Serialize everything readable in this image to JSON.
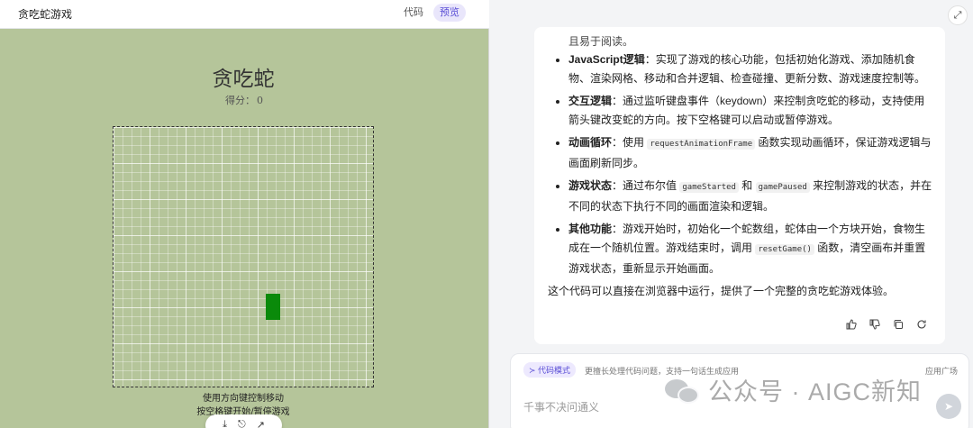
{
  "left": {
    "title": "贪吃蛇游戏",
    "tabs": [
      {
        "label": "代码"
      },
      {
        "label": "预览"
      }
    ],
    "game": {
      "title": "贪吃蛇",
      "score_label": "得分：",
      "score_value": "0",
      "hint_line1": "使用方向键控制移动",
      "hint_line2": "按空格键开始/暂停游戏"
    },
    "floatbar": {
      "icons": [
        "download-icon",
        "share-icon",
        "open-external-icon"
      ],
      "glyphs": [
        "⤓",
        "⎋",
        "↗"
      ]
    }
  },
  "right": {
    "top_cut": "且易于阅读。",
    "items": [
      {
        "label": "JavaScript逻辑",
        "text": "：实现了游戏的核心功能，包括初始化游戏、添加随机食物、渲染网格、移动和合并逻辑、检查碰撞、更新分数、游戏速度控制等。"
      },
      {
        "label": "交互逻辑",
        "text": "：通过监听键盘事件（keydown）来控制贪吃蛇的移动，支持使用箭头键改变蛇的方向。按下空格键可以启动或暂停游戏。"
      },
      {
        "label": "动画循环",
        "pre": "：使用 ",
        "code": "requestAnimationFrame",
        "post": " 函数实现动画循环，保证游戏逻辑与画面刷新同步。"
      },
      {
        "label": "游戏状态",
        "pre": "：通过布尔值 ",
        "code": "gameStarted",
        "mid": " 和 ",
        "code2": "gamePaused",
        "post": " 来控制游戏的状态，并在不同的状态下执行不同的画面渲染和逻辑。"
      },
      {
        "label": "其他功能",
        "pre": "：游戏开始时，初始化一个蛇数组，蛇体由一个方块开始，食物生成在一个随机位置。游戏结束时，调用 ",
        "code": "resetGame()",
        "post": " 函数，清空画布并重置游戏状态，重新显示开始画面。"
      }
    ],
    "summary": "这个代码可以直接在浏览器中运行，提供了一个完整的贪吃蛇游戏体验。",
    "actions": [
      {
        "name": "thumbs-up-icon",
        "glyph": "👍"
      },
      {
        "name": "thumbs-down-icon",
        "glyph": "👎"
      },
      {
        "name": "copy-icon",
        "glyph": "⧉"
      },
      {
        "name": "regenerate-icon",
        "glyph": "↻"
      }
    ],
    "input": {
      "mode_badge": "≻ 代码模式",
      "mode_desc": "更擅长处理代码问题，支持一句话生成应用",
      "apps": "应用广场",
      "placeholder": "千事不决问通义",
      "send_glyph": "➤"
    },
    "watermark": "公众号 · AIGC新知",
    "expand_glyph": "⤢"
  }
}
